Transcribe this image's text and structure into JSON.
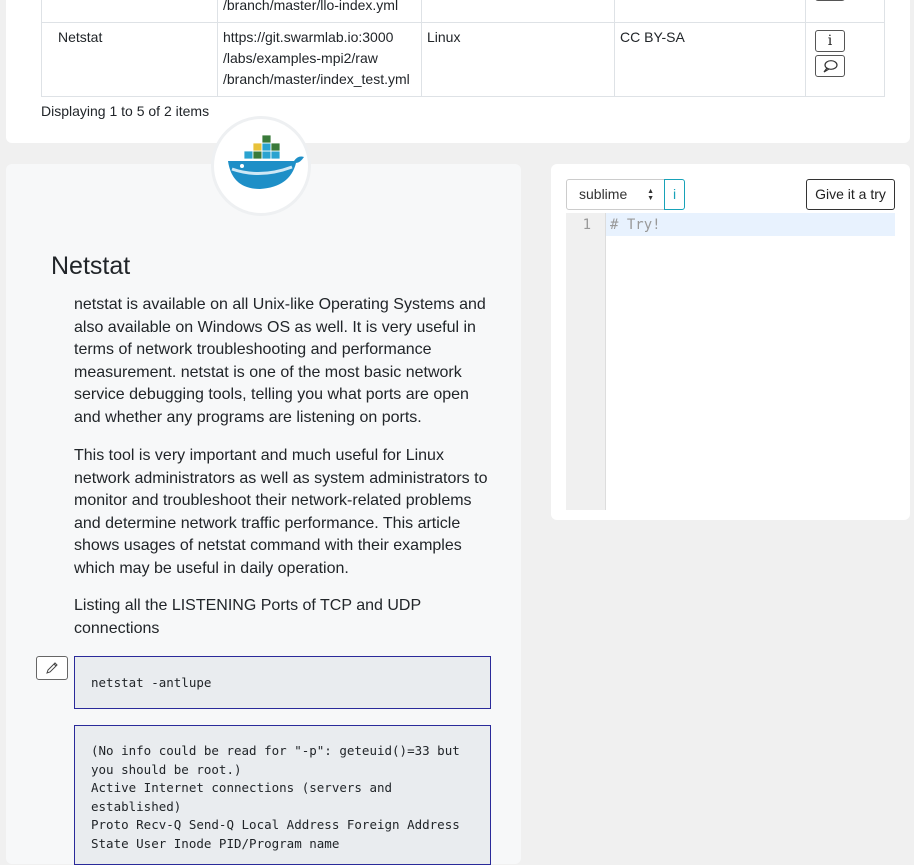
{
  "table": {
    "rows": [
      {
        "name": "",
        "url_lines": [
          "/branch/master/llo-index.yml"
        ],
        "os": "",
        "license": "",
        "partial": true
      },
      {
        "name": "Netstat",
        "url_lines": [
          "https://git.swarmlab.io:3000",
          "/labs/examples-mpi2/raw",
          "/branch/master/index_test.yml"
        ],
        "os": "Linux",
        "license": "CC BY-SA",
        "partial": false
      }
    ],
    "info_glyph": "i",
    "display_count": "Displaying 1 to 5 of 2 items"
  },
  "doc": {
    "title": "Netstat",
    "paragraphs": [
      "netstat is available on all Unix-like Operating Systems and also available on Windows OS as well. It is very useful in terms of network troubleshooting and performance measurement. netstat is one of the most basic network service debugging tools, telling you what ports are open and whether any programs are listening on ports.",
      "This tool is very important and much useful for Linux network administrators as well as system administrators to monitor and troubleshoot their network-related problems and determine network traffic performance. This article shows usages of netstat command with their examples which may be useful in daily operation.",
      "Listing all the LISTENING Ports of TCP and UDP connections"
    ],
    "command": "netstat -antlupe",
    "output": "(No info could be read for \"-p\": geteuid()=33 but you should be root.)\nActive Internet connections (servers and established)\nProto Recv-Q Send-Q Local Address Foreign Address State User Inode PID/Program name"
  },
  "editor": {
    "theme": "sublime",
    "info_label": "i",
    "try_label": "Give it a try",
    "line_number": "1",
    "content": "# Try!"
  },
  "icons": {
    "info": "info-icon",
    "comment": "comment-icon",
    "edit": "pencil-icon",
    "logo": "docker-whale-icon"
  }
}
